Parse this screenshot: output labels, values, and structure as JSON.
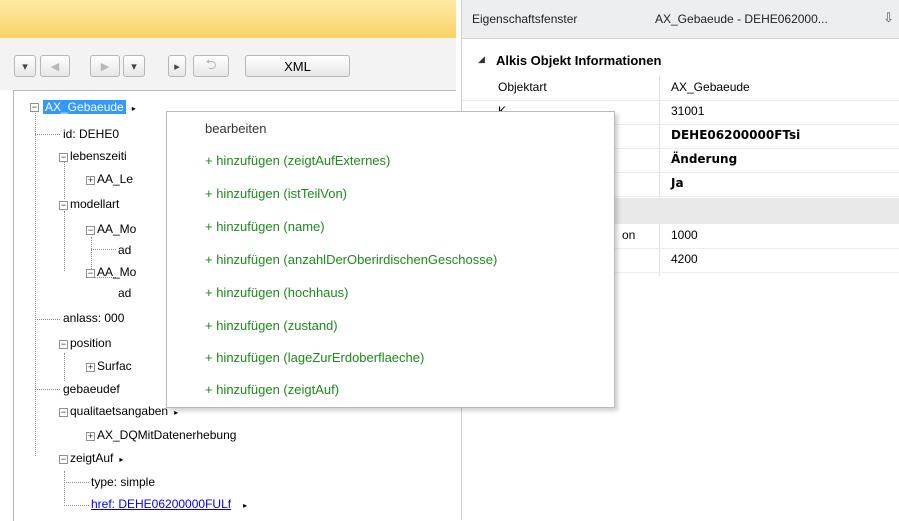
{
  "toolbar": {
    "dropdown_glyph": "▾",
    "back_glyph": "◀",
    "forward_glyph": "▶",
    "more_glyph": "▸",
    "return_glyph": "⮌",
    "xml_label": "XML"
  },
  "tree": {
    "root_label": "AX_Gebaeude",
    "id_label": "id: DEHE0",
    "lebenszeit_label": "lebenszeiti",
    "aa_le_label": "AA_Le",
    "modellart_label": "modellart",
    "aa_mo1_label": "AA_Mo",
    "ad1_label": "ad",
    "aa_mo2_label": "AA_Mo",
    "ad2_label": "ad",
    "anlass_label": "anlass: 000",
    "position_label": "position",
    "surface_label": "Surfac",
    "gebaeudef_label": "gebaeudef",
    "qualitaet_label": "qualitaetsangaben",
    "dqm_label": "AX_DQMitDatenerhebung",
    "zeigtauf_label": "zeigtAuf",
    "type_label": "type: simple",
    "href_label": "href: DEHE06200000FULf",
    "expand_minus": "−",
    "expand_plus": "+",
    "arrow_glyph": "▸"
  },
  "context_menu": {
    "edit_label": "bearbeiten",
    "items": [
      "+ hinzufügen (zeigtAufExternes)",
      "+ hinzufügen (istTeilVon)",
      "+ hinzufügen (name)",
      "+ hinzufügen (anzahlDerOberirdischenGeschosse)",
      "+ hinzufügen (hochhaus)",
      "+ hinzufügen (zustand)",
      "+ hinzufügen (lageZurErdoberflaeche)",
      "+ hinzufügen (zeigtAuf)"
    ]
  },
  "properties": {
    "panel_title": "Eigenschaftsfenster",
    "object_label": "AX_Gebaeude - DEHE062000...",
    "pin_glyph": "⇩",
    "category_glyph": "◢",
    "category_title": "Alkis Objekt Informationen",
    "rows": [
      {
        "name": "Objektart",
        "value": "AX_Gebaeude"
      },
      {
        "name": "K",
        "value": "31001"
      },
      {
        "name": "",
        "value": "DEHE06200000FTsi"
      },
      {
        "name": "",
        "value": "Änderung"
      },
      {
        "name": "",
        "value": "Ja"
      }
    ],
    "rows2": [
      {
        "name": "on",
        "value": "1000"
      },
      {
        "name": "",
        "value": "4200"
      }
    ]
  },
  "colors": {
    "selection": "#3399ff",
    "menu_green": "#1e8a1e",
    "header_yellow": "#fbd466",
    "link_blue": "#0000ee"
  }
}
